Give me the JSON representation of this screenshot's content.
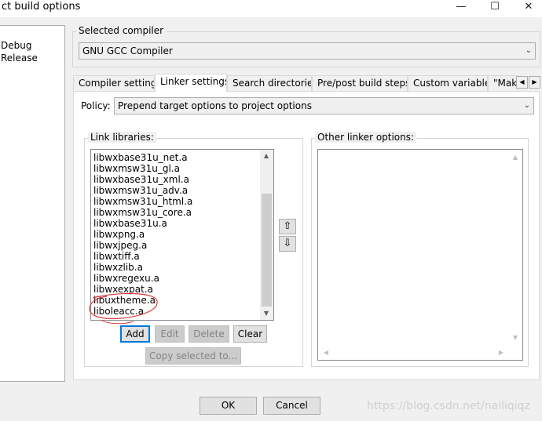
{
  "window": {
    "title": "ct build options",
    "minimize": "—",
    "maximize": "☐",
    "close": "✕"
  },
  "targets": [
    "Debug",
    "Release"
  ],
  "compiler": {
    "label": "Selected compiler",
    "value": "GNU GCC Compiler"
  },
  "tabs": [
    {
      "label": "Compiler settings"
    },
    {
      "label": "Linker settings"
    },
    {
      "label": "Search directories"
    },
    {
      "label": "Pre/post build steps"
    },
    {
      "label": "Custom variables"
    },
    {
      "label": "\"Make"
    }
  ],
  "policy": {
    "label": "Policy:",
    "value": "Prepend target options to project options"
  },
  "link_libraries": {
    "label": "Link libraries:",
    "items": [
      "libwxbase31u_net.a",
      "libwxmsw31u_gl.a",
      "libwxbase31u_xml.a",
      "libwxmsw31u_adv.a",
      "libwxmsw31u_html.a",
      "libwxmsw31u_core.a",
      "libwxbase31u.a",
      "libwxpng.a",
      "libwxjpeg.a",
      "libwxtiff.a",
      "libwxzlib.a",
      "libwxregexu.a",
      "libwxexpat.a",
      "libuxtheme.a",
      "liboleacc.a"
    ],
    "add": "Add",
    "edit": "Edit",
    "delete": "Delete",
    "clear": "Clear",
    "copy_selected": "Copy selected to..."
  },
  "other_linker": {
    "label": "Other linker options:"
  },
  "footer": {
    "ok": "OK",
    "cancel": "Cancel"
  },
  "watermark": "https://blog.csdn.net/nailiqiqz",
  "icons": {
    "move_up": "⇧",
    "move_down": "⇩",
    "dropdown": "chevron-down-icon"
  }
}
